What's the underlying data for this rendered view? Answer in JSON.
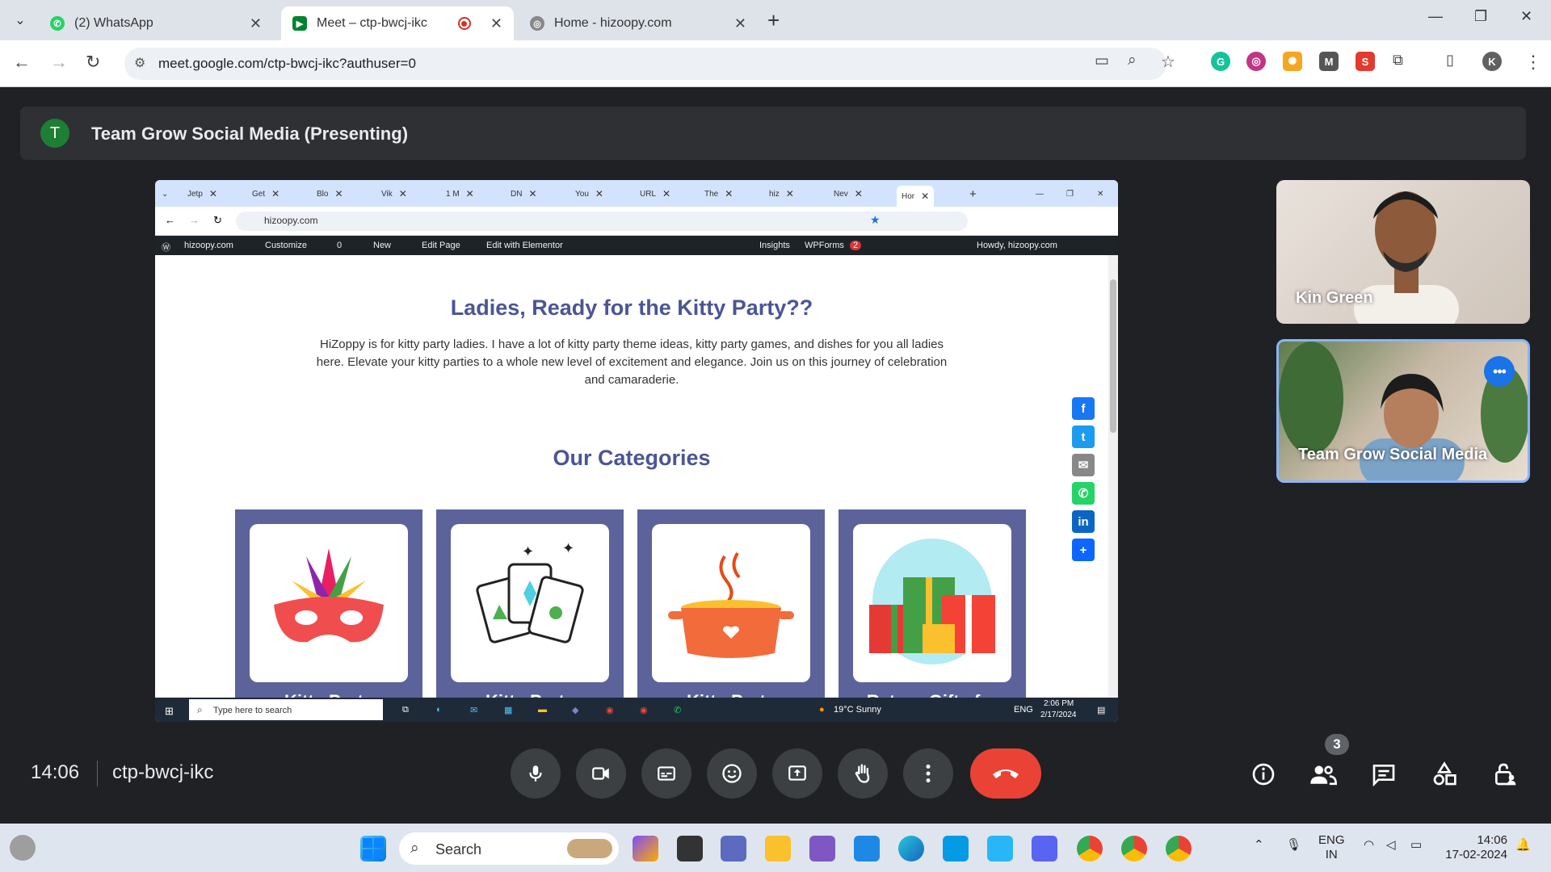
{
  "browser": {
    "tabs": [
      {
        "title": "(2) WhatsApp",
        "active": false
      },
      {
        "title": "Meet – ctp-bwcj-ikc",
        "active": true
      },
      {
        "title": "Home - hizoopy.com",
        "active": false
      }
    ],
    "url": "meet.google.com/ctp-bwcj-ikc?authuser=0",
    "profile_initial": "K"
  },
  "meet": {
    "header_initial": "T",
    "header_title": "Team Grow Social Media (Presenting)",
    "time": "14:06",
    "meeting_code": "ctp-bwcj-ikc",
    "participant_count": "3",
    "participants": [
      {
        "name": "Kin Green"
      },
      {
        "name": "Team Grow Social Media"
      }
    ]
  },
  "shared_screen": {
    "tabs": [
      "Jetp",
      "Get",
      "Blo",
      "Vik",
      "1 M",
      "DN",
      "You",
      "URL",
      "The",
      "hiz",
      "Nev",
      "Hor"
    ],
    "url": "hizoopy.com",
    "admin_bar": {
      "site": "hizoopy.com",
      "customize": "Customize",
      "comments": "0",
      "new": "New",
      "edit_page": "Edit Page",
      "edit_elementor": "Edit with Elementor",
      "insights": "Insights",
      "wpforms": "WPForms",
      "wpforms_count": "2",
      "howdy": "Howdy, hizoopy.com"
    },
    "heading": "Ladies, Ready for the Kitty Party??",
    "intro": "HiZoppy is for kitty party ladies. I have a lot of kitty party theme ideas, kitty party games, and dishes for you all ladies here. Elevate your kitty parties to a whole new level of excitement and elegance. Join us on this journey of celebration and camaraderie.",
    "categories_heading": "Our Categories",
    "categories": [
      {
        "caption": "Kitty Party",
        "icon": "party-mask-icon"
      },
      {
        "caption": "Kitty Party",
        "icon": "playing-cards-icon"
      },
      {
        "caption": "Kitty Party",
        "icon": "cooking-pot-icon"
      },
      {
        "caption": "Return Gifts for",
        "icon": "gift-boxes-icon"
      }
    ],
    "share_icons": [
      "facebook-icon",
      "twitter-icon",
      "email-icon",
      "whatsapp-icon",
      "linkedin-icon",
      "share-plus-icon"
    ],
    "taskbar": {
      "search_placeholder": "Type here to search",
      "weather": "19°C  Sunny",
      "lang": "ENG",
      "time": "2:06 PM",
      "date": "2/17/2024"
    }
  },
  "windows_taskbar": {
    "search_label": "Search",
    "lang_line1": "ENG",
    "lang_line2": "IN",
    "time": "14:06",
    "date": "17-02-2024"
  }
}
